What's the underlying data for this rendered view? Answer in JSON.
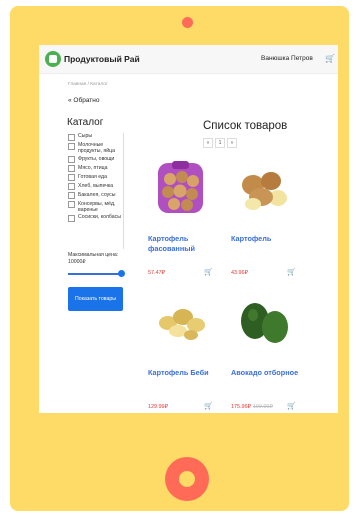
{
  "header": {
    "brand": "Продуктовый Рай",
    "user": "Ванюшка Петров"
  },
  "breadcrumb": "Главная / Каталог",
  "back_label": "« Обратно",
  "sidebar": {
    "title": "Каталог",
    "categories": [
      "Сыры",
      "Молочные продукты, яйца",
      "Фрукты, овощи",
      "Мясо, птица",
      "Готовая еда",
      "Хлеб, выпечка",
      "Бакалея, соусы",
      "Консервы, мёд, варенье",
      "Сосиски, колбасы"
    ],
    "price_label": "Максимальная цена: 10000₽",
    "price_value": 10000,
    "show_button": "Показать товары"
  },
  "main": {
    "title": "Список товаров",
    "pager": {
      "prev": "«",
      "current": "1",
      "next": "»"
    },
    "products": [
      {
        "name": "Картофель фасованный",
        "price": "57.47₽",
        "old_price": ""
      },
      {
        "name": "Картофель",
        "price": "43.96₽",
        "old_price": ""
      },
      {
        "name": "Картофель Беби",
        "price": "129.99₽",
        "old_price": ""
      },
      {
        "name": "Авокадо отборное",
        "price": "175.96₽",
        "old_price": "199.99₽"
      }
    ]
  },
  "colors": {
    "frame": "#fedb66",
    "accent": "#1a73e8",
    "price": "#e53935",
    "camera": "#ff6b57"
  },
  "icons": [
    "cart-icon",
    "logo-icon",
    "checkbox-icon"
  ]
}
